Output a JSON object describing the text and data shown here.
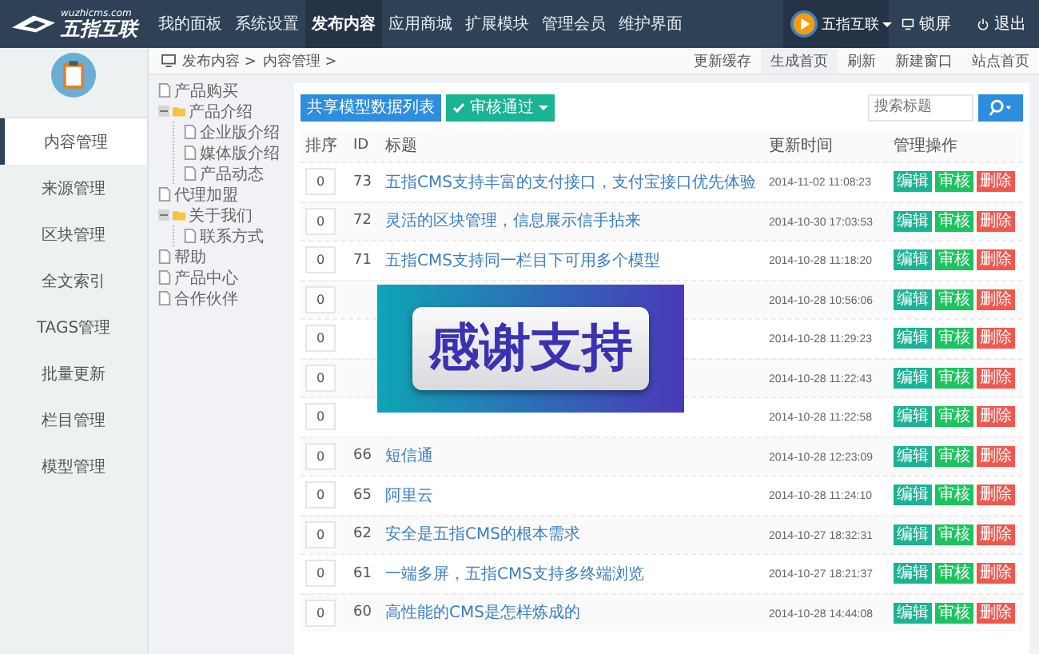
{
  "topbar": {
    "logo_domain": "wuzhicms.com",
    "logo_name": "五指互联",
    "nav": [
      {
        "label": "我的面板",
        "selected": false
      },
      {
        "label": "系统设置",
        "selected": false
      },
      {
        "label": "发布内容",
        "selected": true
      },
      {
        "label": "应用商城",
        "selected": false
      },
      {
        "label": "扩展模块",
        "selected": false
      },
      {
        "label": "管理会员",
        "selected": false
      },
      {
        "label": "维护界面",
        "selected": false
      }
    ],
    "user": {
      "name": "五指互联"
    },
    "actions": [
      {
        "kind": "lock",
        "label": "锁屏"
      },
      {
        "kind": "logout",
        "label": "退出"
      }
    ]
  },
  "sidebar": {
    "items": [
      {
        "label": "内容管理",
        "selected": true
      },
      {
        "label": "来源管理",
        "selected": false
      },
      {
        "label": "区块管理",
        "selected": false
      },
      {
        "label": "全文索引",
        "selected": false
      },
      {
        "label": "TAGS管理",
        "selected": false
      },
      {
        "label": "批量更新",
        "selected": false
      },
      {
        "label": "栏目管理",
        "selected": false
      },
      {
        "label": "模型管理",
        "selected": false
      }
    ]
  },
  "breadcrumb": [
    "发布内容 >",
    "内容管理 >"
  ],
  "top_links": [
    {
      "label": "更新缓存",
      "selected": false
    },
    {
      "label": "生成首页",
      "selected": true
    },
    {
      "label": "刷新",
      "selected": false
    },
    {
      "label": "新建窗口",
      "selected": false
    },
    {
      "label": "站点首页",
      "selected": false
    }
  ],
  "tree": [
    {
      "kind": "page",
      "label": "产品购买"
    },
    {
      "kind": "folder",
      "label": "产品介绍",
      "expanded": true,
      "children": [
        {
          "kind": "page",
          "label": "企业版介绍"
        },
        {
          "kind": "page",
          "label": "媒体版介绍"
        },
        {
          "kind": "page",
          "label": "产品动态"
        }
      ]
    },
    {
      "kind": "page",
      "label": "代理加盟"
    },
    {
      "kind": "folder",
      "label": "关于我们",
      "expanded": true,
      "children": [
        {
          "kind": "page",
          "label": "联系方式"
        }
      ]
    },
    {
      "kind": "page",
      "label": "帮助"
    },
    {
      "kind": "page",
      "label": "产品中心"
    },
    {
      "kind": "page",
      "label": "合作伙伴"
    }
  ],
  "toolbar": {
    "buttons": [
      {
        "kind": "primary",
        "label": "共享模型数据列表"
      },
      {
        "kind": "dropdown",
        "label": "审核通过"
      }
    ],
    "search": {
      "placeholder": "搜索标题"
    }
  },
  "table": {
    "columns": [
      "排序",
      "ID",
      "标题",
      "更新时间",
      "管理操作"
    ],
    "rows": [
      {
        "sort": "0",
        "id": "73",
        "title": "五指CMS支持丰富的支付接口，支付宝接口优先体验",
        "time": "2014-11-02 11:08:23",
        "actions": [
          "编辑",
          "审核",
          "删除"
        ]
      },
      {
        "sort": "0",
        "id": "72",
        "title": "灵活的区块管理，信息展示信手拈来",
        "time": "2014-10-30 17:03:53",
        "actions": [
          "编辑",
          "审核",
          "删除"
        ]
      },
      {
        "sort": "0",
        "id": "71",
        "title": "五指CMS支持同一栏目下可用多个模型",
        "time": "2014-10-28 11:18:20",
        "actions": [
          "编辑",
          "审核",
          "删除"
        ]
      },
      {
        "sort": "0",
        "time": "2014-10-28 10:56:06",
        "actions": [
          "编辑",
          "审核",
          "删除"
        ]
      },
      {
        "sort": "0",
        "time": "2014-10-28 11:29:23",
        "actions": [
          "编辑",
          "审核",
          "删除"
        ]
      },
      {
        "sort": "0",
        "time": "2014-10-28 11:22:43",
        "actions": [
          "编辑",
          "审核",
          "删除"
        ]
      },
      {
        "sort": "0",
        "time": "2014-10-28 11:22:58",
        "actions": [
          "编辑",
          "审核",
          "删除"
        ]
      },
      {
        "sort": "0",
        "id": "66",
        "title": "短信通",
        "time": "2014-10-28 12:23:09",
        "actions": [
          "编辑",
          "审核",
          "删除"
        ]
      },
      {
        "sort": "0",
        "id": "65",
        "title": "阿里云",
        "time": "2014-10-28 11:24:10",
        "actions": [
          "编辑",
          "审核",
          "删除"
        ]
      },
      {
        "sort": "0",
        "id": "62",
        "title": "安全是五指CMS的根本需求",
        "time": "2014-10-27 18:32:31",
        "actions": [
          "编辑",
          "审核",
          "删除"
        ]
      },
      {
        "sort": "0",
        "id": "61",
        "title": "一端多屏，五指CMS支持多终端浏览",
        "time": "2014-10-27 18:21:37",
        "actions": [
          "编辑",
          "审核",
          "删除"
        ]
      },
      {
        "sort": "0",
        "id": "60",
        "title": "高性能的CMS是怎样炼成的",
        "time": "2014-10-28 14:44:08",
        "actions": [
          "编辑",
          "审核",
          "删除"
        ]
      }
    ]
  },
  "overlay": {
    "text": "感谢支持"
  }
}
